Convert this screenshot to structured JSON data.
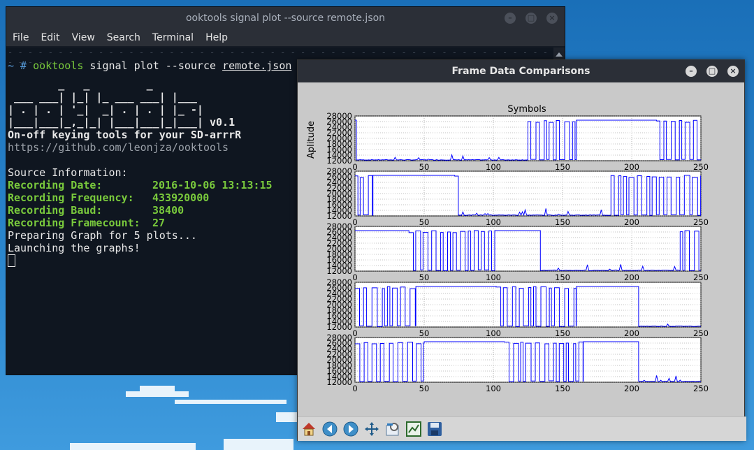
{
  "terminal": {
    "title": "ooktools signal plot --source remote.json",
    "menu": [
      "File",
      "Edit",
      "View",
      "Search",
      "Terminal",
      "Help"
    ],
    "prompt": "~ #",
    "command": "ooktools",
    "command_args": "signal plot --source",
    "command_file": "remote.json",
    "banner": [
      "        _   _         _",
      " ___ ___| |_| |_ ___ ___| |___",
      "| . | . | '_|  _| . | . | |_ -|",
      "|___|___|_,_|_| |___|___|_|___| v0.1"
    ],
    "tagline": "On-off keying tools for your SD-arrrR",
    "url": "https://github.com/leonjza/ooktools",
    "source_heading": "Source Information:",
    "fields": [
      {
        "label": "Recording Date:",
        "value": "2016-10-06 13:13:15"
      },
      {
        "label": "Recording Frequency:",
        "value": "433920000"
      },
      {
        "label": "Recording Baud:",
        "value": "38400"
      },
      {
        "label": "Recording Framecount:",
        "value": "27"
      }
    ],
    "status1": "Preparing Graph for 5 plots...",
    "status2": "Launching the graphs!"
  },
  "plot_window": {
    "title": "Frame Data Comparisons"
  },
  "chart_data": {
    "type": "line",
    "title": "Symbols",
    "ylabel": "Aplitude",
    "xlim": [
      0,
      250
    ],
    "ylim": [
      12000,
      28000
    ],
    "xticks": [
      "0",
      "50",
      "100",
      "150",
      "200",
      "250"
    ],
    "yticks": [
      "12000",
      "14000",
      "16000",
      "18000",
      "20000",
      "22000",
      "24000",
      "26000",
      "28000"
    ],
    "grid": true,
    "color": "#0000ff",
    "plots": [
      {
        "segments": [
          [
            0,
            1,
            "H"
          ],
          [
            1,
            125,
            "L"
          ],
          [
            125,
            160,
            "A"
          ],
          [
            160,
            218,
            "H"
          ],
          [
            218,
            250,
            "A"
          ]
        ]
      },
      {
        "segments": [
          [
            0,
            13,
            "A"
          ],
          [
            13,
            72,
            "H"
          ],
          [
            72,
            75,
            "A"
          ],
          [
            75,
            185,
            "L"
          ],
          [
            185,
            250,
            "A"
          ]
        ]
      },
      {
        "segments": [
          [
            0,
            39,
            "H"
          ],
          [
            39,
            101,
            "A"
          ],
          [
            101,
            134,
            "H"
          ],
          [
            134,
            235,
            "L"
          ],
          [
            235,
            250,
            "A"
          ]
        ]
      },
      {
        "segments": [
          [
            0,
            44,
            "A"
          ],
          [
            44,
            102,
            "H"
          ],
          [
            102,
            160,
            "A"
          ],
          [
            160,
            205,
            "H"
          ],
          [
            205,
            250,
            "L"
          ]
        ]
      },
      {
        "segments": [
          [
            0,
            50,
            "A"
          ],
          [
            50,
            108,
            "H"
          ],
          [
            108,
            165,
            "A"
          ],
          [
            165,
            205,
            "H"
          ],
          [
            205,
            250,
            "L"
          ]
        ]
      }
    ]
  },
  "toolbar": {
    "icons": [
      "home-icon",
      "back-icon",
      "forward-icon",
      "pan-icon",
      "zoom-icon",
      "subplots-icon",
      "save-icon"
    ]
  }
}
